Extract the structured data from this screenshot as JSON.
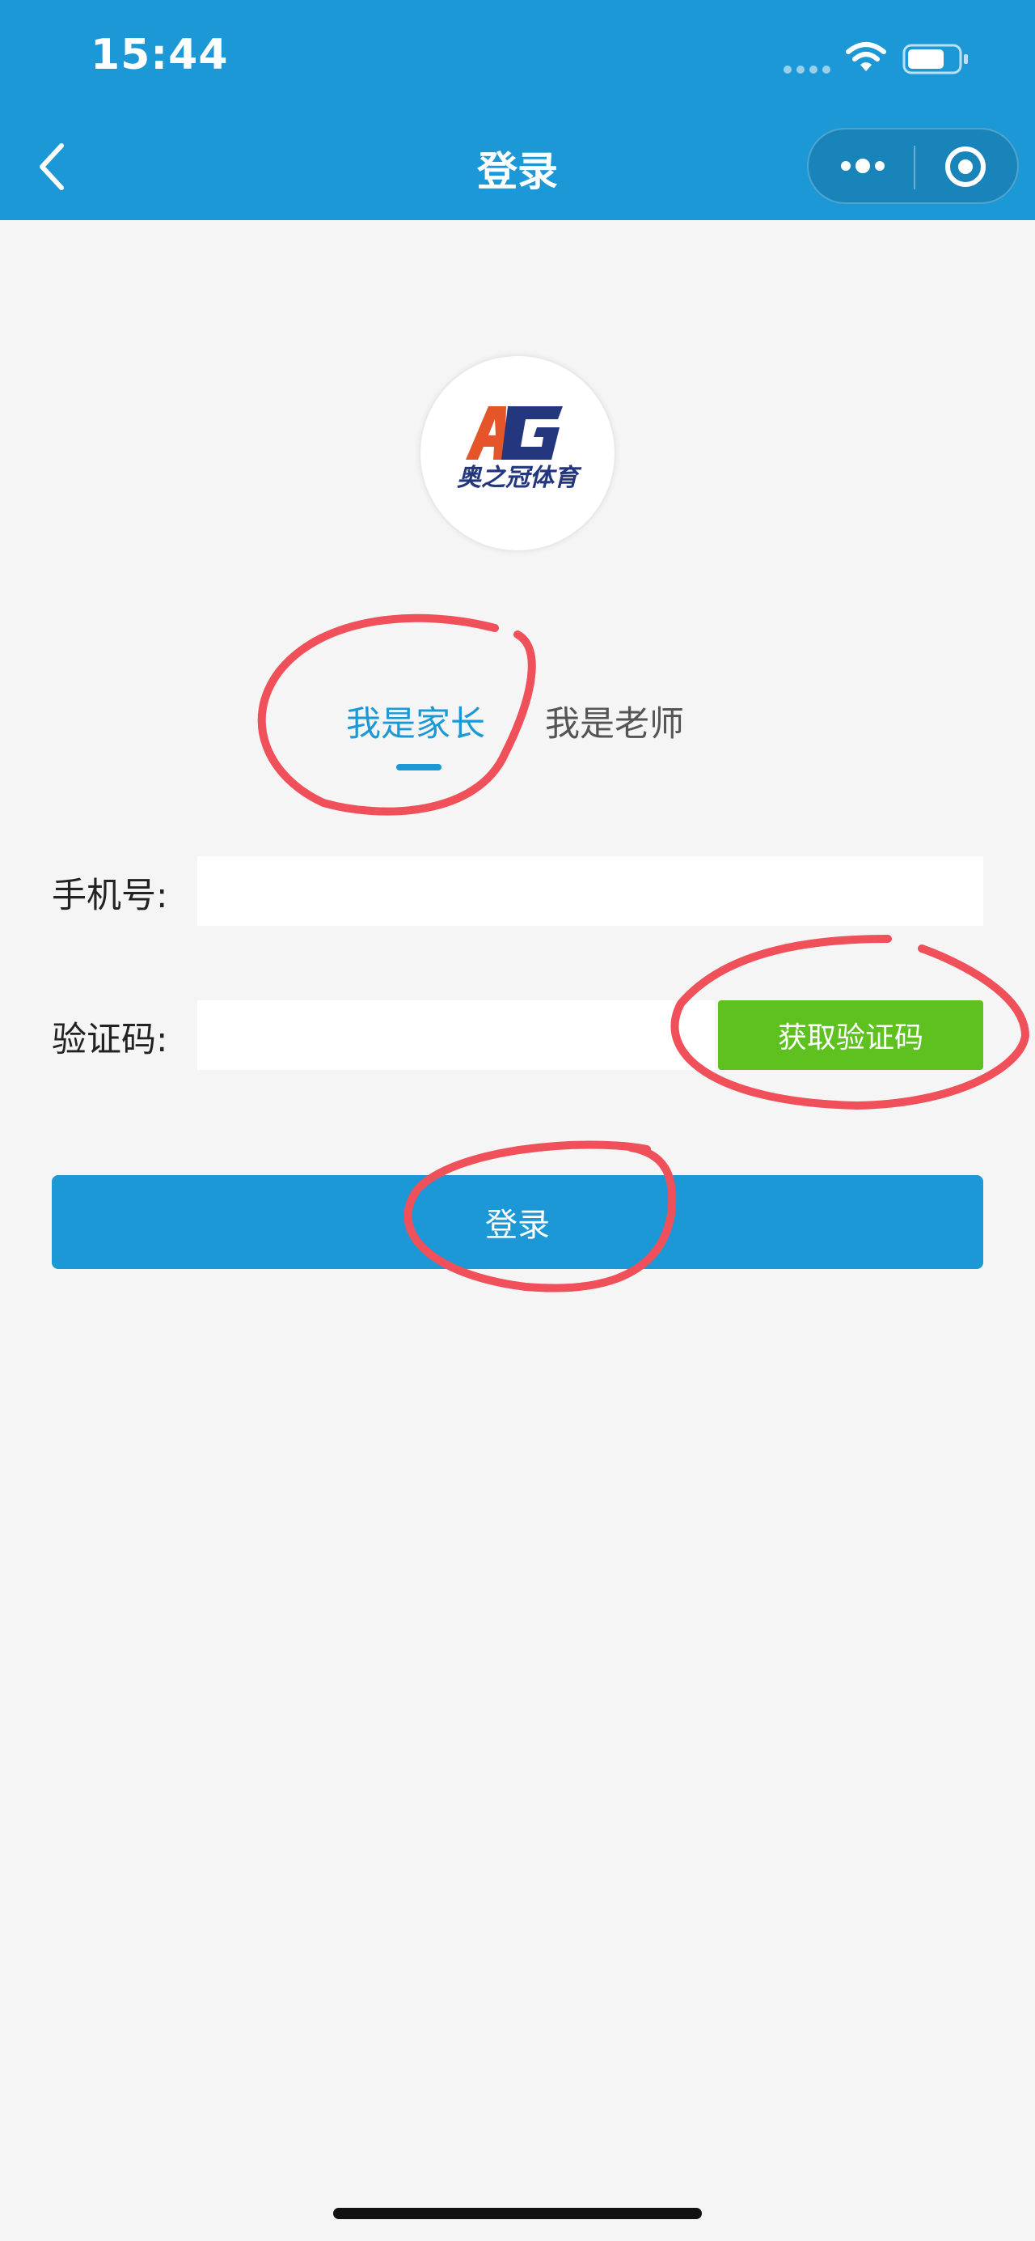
{
  "status_bar": {
    "time": "15:44"
  },
  "nav": {
    "title": "登录"
  },
  "logo": {
    "text_top": "AG",
    "text_bottom": "奥之冠体育"
  },
  "tabs": [
    {
      "label": "我是家长",
      "active": true
    },
    {
      "label": "我是老师",
      "active": false
    }
  ],
  "form": {
    "phone_label": "手机号:",
    "phone_value": "",
    "code_label": "验证码:",
    "code_value": "",
    "get_code_label": "获取验证码"
  },
  "login_label": "登录",
  "colors": {
    "primary": "#1c98d6",
    "code_button": "#5ec11f",
    "annotation": "#f0505a",
    "background": "#f5f5f5"
  },
  "icons": [
    "back-icon",
    "more-icon",
    "close-mini-program-icon",
    "wifi-icon",
    "battery-icon",
    "signal-icon"
  ]
}
